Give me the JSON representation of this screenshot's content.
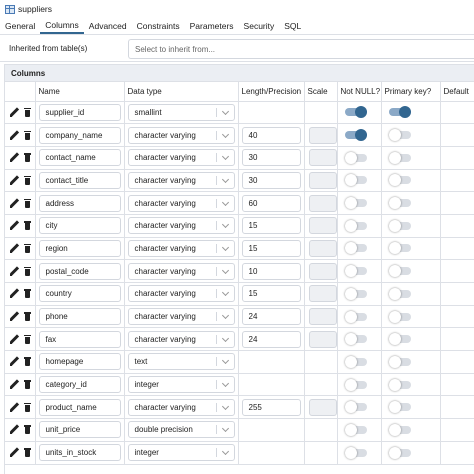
{
  "title": "suppliers",
  "tabs": [
    "General",
    "Columns",
    "Advanced",
    "Constraints",
    "Parameters",
    "Security",
    "SQL"
  ],
  "active_tab": "Columns",
  "inherit": {
    "label": "Inherited from table(s)",
    "placeholder": "Select to inherit from..."
  },
  "columns_section": {
    "title": "Columns",
    "headers": {
      "name": "Name",
      "data_type": "Data type",
      "length": "Length/Precision",
      "scale": "Scale",
      "not_null": "Not NULL?",
      "primary_key": "Primary key?",
      "default": "Default"
    }
  },
  "rows": [
    {
      "name": "supplier_id",
      "data_type": "smallint",
      "length": "",
      "scale_enabled": false,
      "not_null": true,
      "primary_key": true
    },
    {
      "name": "company_name",
      "data_type": "character varying",
      "length": "40",
      "scale_enabled": true,
      "not_null": true,
      "primary_key": false
    },
    {
      "name": "contact_name",
      "data_type": "character varying",
      "length": "30",
      "scale_enabled": true,
      "not_null": false,
      "primary_key": false
    },
    {
      "name": "contact_title",
      "data_type": "character varying",
      "length": "30",
      "scale_enabled": true,
      "not_null": false,
      "primary_key": false
    },
    {
      "name": "address",
      "data_type": "character varying",
      "length": "60",
      "scale_enabled": true,
      "not_null": false,
      "primary_key": false
    },
    {
      "name": "city",
      "data_type": "character varying",
      "length": "15",
      "scale_enabled": true,
      "not_null": false,
      "primary_key": false
    },
    {
      "name": "region",
      "data_type": "character varying",
      "length": "15",
      "scale_enabled": true,
      "not_null": false,
      "primary_key": false
    },
    {
      "name": "postal_code",
      "data_type": "character varying",
      "length": "10",
      "scale_enabled": true,
      "not_null": false,
      "primary_key": false
    },
    {
      "name": "country",
      "data_type": "character varying",
      "length": "15",
      "scale_enabled": true,
      "not_null": false,
      "primary_key": false
    },
    {
      "name": "phone",
      "data_type": "character varying",
      "length": "24",
      "scale_enabled": true,
      "not_null": false,
      "primary_key": false
    },
    {
      "name": "fax",
      "data_type": "character varying",
      "length": "24",
      "scale_enabled": true,
      "not_null": false,
      "primary_key": false
    },
    {
      "name": "homepage",
      "data_type": "text",
      "length": "",
      "scale_enabled": false,
      "not_null": false,
      "primary_key": false
    },
    {
      "name": "category_id",
      "data_type": "integer",
      "length": "",
      "scale_enabled": false,
      "not_null": false,
      "primary_key": false
    },
    {
      "name": "product_name",
      "data_type": "character varying",
      "length": "255",
      "scale_enabled": true,
      "not_null": false,
      "primary_key": false
    },
    {
      "name": "unit_price",
      "data_type": "double precision",
      "length": "",
      "scale_enabled": false,
      "not_null": false,
      "primary_key": false
    },
    {
      "name": "units_in_stock",
      "data_type": "integer",
      "length": "",
      "scale_enabled": false,
      "not_null": false,
      "primary_key": false
    }
  ],
  "colors": {
    "accent": "#326690",
    "toggle_on_track": "#8ba9c7",
    "toggle_off_track": "#d9dde3",
    "border": "#dde0e6",
    "header_bg": "#ebeef3"
  },
  "icons": {
    "edit": "pencil-icon",
    "delete": "trash-icon",
    "table": "table-icon",
    "dropdown": "chevron-down-icon"
  }
}
